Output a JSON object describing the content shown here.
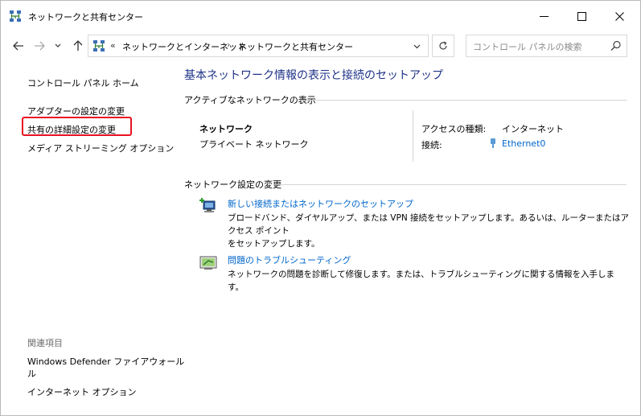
{
  "window": {
    "title": "ネットワークと共有センター"
  },
  "address_bar": {
    "overflow": "«",
    "crumbs": [
      "ネットワークとインターネット",
      "ネットワークと共有センター"
    ],
    "separator": "›"
  },
  "search": {
    "placeholder": "コントロール パネルの検索"
  },
  "left_pane": {
    "home": "コントロール パネル ホーム",
    "links": [
      "アダプターの設定の変更",
      "共有の詳細設定の変更",
      "メディア ストリーミング オプション"
    ],
    "related_heading": "関連項目",
    "related": [
      "Windows Defender ファイアウォール",
      "ル",
      "インターネット オプション"
    ]
  },
  "main": {
    "title": "基本ネットワーク情報の表示と接続のセットアップ",
    "active_section": "アクティブなネットワークの表示",
    "network": {
      "name": "ネットワーク",
      "type": "プライベート ネットワーク",
      "access_label": "アクセスの種類:",
      "access_value": "インターネット",
      "conn_label": "接続:",
      "conn_value": "Ethernet0"
    },
    "change_section": "ネットワーク設定の変更",
    "tasks": [
      {
        "title": "新しい接続またはネットワークのセットアップ",
        "desc_line1": "ブロードバンド、ダイヤルアップ、または VPN 接続をセットアップします。あるいは、ルーターまたはアクセス ポイント",
        "desc_line2": "をセットアップします。"
      },
      {
        "title": "問題のトラブルシューティング",
        "desc_line1": "ネットワークの問題を診断して修復します。または、トラブルシューティングに関する情報を入手します。"
      }
    ]
  },
  "colors": {
    "link": "#0066cc",
    "title": "#1e3287",
    "highlight": "#e81123"
  }
}
